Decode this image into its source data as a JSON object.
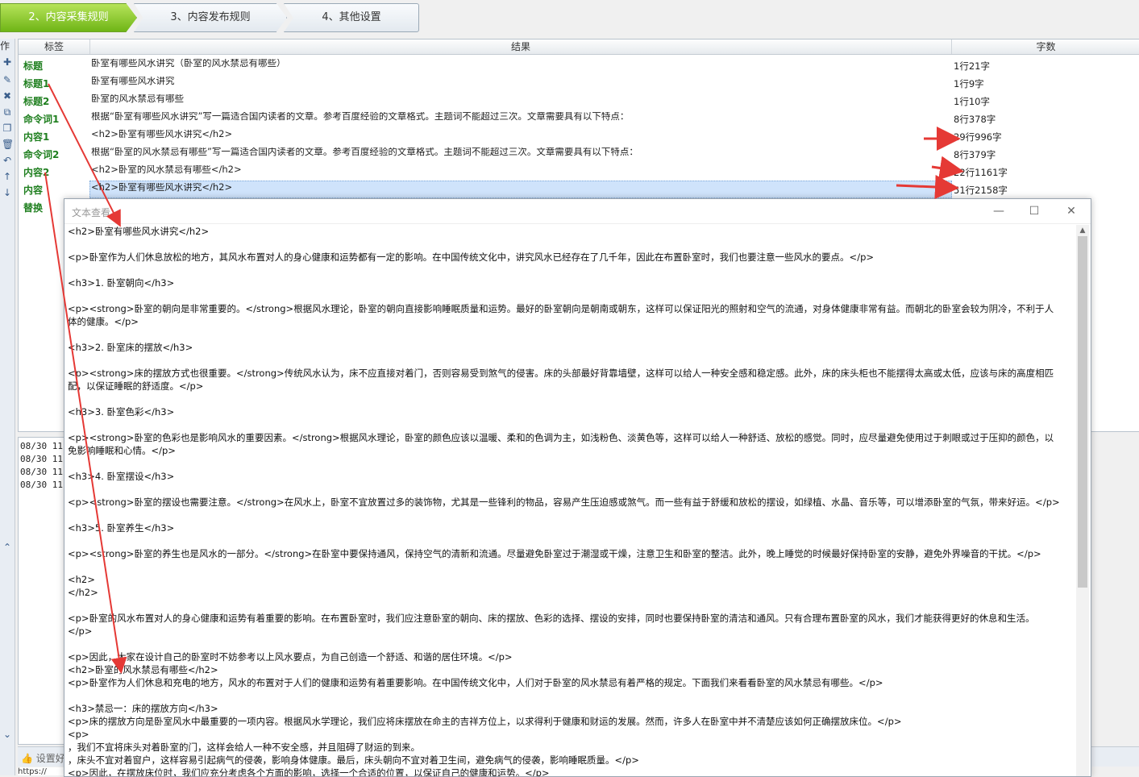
{
  "steps": {
    "tab2": "2、内容采集规则",
    "tab3": "3、内容发布规则",
    "tab4": "4、其他设置"
  },
  "toolstrip": {
    "label": "作"
  },
  "grid": {
    "headers": {
      "tag": "标签",
      "result": "结果",
      "count": "字数"
    },
    "rows": [
      {
        "tag": "标题",
        "result": "卧室有哪些风水讲究（卧室的风水禁忌有哪些）",
        "count": "1行21字"
      },
      {
        "tag": "标题1",
        "result": "卧室有哪些风水讲究",
        "count": "1行9字"
      },
      {
        "tag": "标题2",
        "result": "卧室的风水禁忌有哪些",
        "count": "1行10字"
      },
      {
        "tag": "命令词1",
        "result": "根据“卧室有哪些风水讲究”写一篇适合国内读者的文章。参考百度经验的文章格式。主题词不能超过三次。文章需要具有以下特点：",
        "count": "8行378字"
      },
      {
        "tag": "内容1",
        "result": "<h2>卧室有哪些风水讲究</h2>",
        "count": "29行996字"
      },
      {
        "tag": "命令词2",
        "result": "根据“卧室的风水禁忌有哪些”写一篇适合国内读者的文章。参考百度经验的文章格式。主题词不能超过三次。文章需要具有以下特点：",
        "count": "8行379字"
      },
      {
        "tag": "内容2",
        "result": "<h2>卧室的风水禁忌有哪些</h2>",
        "count": "22行1161字"
      },
      {
        "tag": "内容",
        "result": "<h2>卧室有哪些风水讲究</h2>",
        "count": "51行2158字"
      },
      {
        "tag": "替换",
        "result": "",
        "count": ""
      }
    ]
  },
  "log": {
    "lines": [
      "08/30 11:5",
      "08/30 11:5",
      "08/30 11:5",
      "08/30 11:5"
    ]
  },
  "status": {
    "label": "设置好"
  },
  "bottom": {
    "text": "https://"
  },
  "dialog": {
    "title": "文本查看",
    "lines": [
      "<h2>卧室有哪些风水讲究</h2>",
      "",
      "<p>卧室作为人们休息放松的地方，其风水布置对人的身心健康和运势都有一定的影响。在中国传统文化中，讲究风水已经存在了几千年，因此在布置卧室时，我们也要注意一些风水的要点。</p>",
      "",
      "<h3>1. 卧室朝向</h3>",
      "",
      "<p><strong>卧室的朝向是非常重要的。</strong>根据风水理论，卧室的朝向直接影响睡眠质量和运势。最好的卧室朝向是朝南或朝东，这样可以保证阳光的照射和空气的流通，对身体健康非常有益。而朝北的卧室会较为阴冷，不利于人",
      "体的健康。</p>",
      "",
      "<h3>2. 卧室床的摆放</h3>",
      "",
      "<p><strong>床的摆放方式也很重要。</strong>传统风水认为，床不应直接对着门，否则容易受到煞气的侵害。床的头部最好背靠墙壁，这样可以给人一种安全感和稳定感。此外，床的床头柜也不能摆得太高或太低，应该与床的高度相匹",
      "配，以保证睡眠的舒适度。</p>",
      "",
      "<h3>3. 卧室色彩</h3>",
      "",
      "<p><strong>卧室的色彩也是影响风水的重要因素。</strong>根据风水理论，卧室的颜色应该以温暖、柔和的色调为主，如浅粉色、淡黄色等，这样可以给人一种舒适、放松的感觉。同时，应尽量避免使用过于刺眼或过于压抑的颜色，以",
      "免影响睡眠和心情。</p>",
      "",
      "<h3>4. 卧室摆设</h3>",
      "",
      "<p><strong>卧室的摆设也需要注意。</strong>在风水上，卧室不宜放置过多的装饰物，尤其是一些锋利的物品，容易产生压迫感或煞气。而一些有益于舒缓和放松的摆设，如绿植、水晶、音乐等，可以增添卧室的气氛，带来好运。</p>",
      "",
      "<h3>5. 卧室养生</h3>",
      "",
      "<p><strong>卧室的养生也是风水的一部分。</strong>在卧室中要保持通风，保持空气的清新和流通。尽量避免卧室过于潮湿或干燥，注意卫生和卧室的整洁。此外，晚上睡觉的时候最好保持卧室的安静，避免外界噪音的干扰。</p>",
      "",
      "<h2>",
      "</h2>",
      "",
      "<p>卧室的风水布置对人的身心健康和运势有着重要的影响。在布置卧室时，我们应注意卧室的朝向、床的摆放、色彩的选择、摆设的安排，同时也要保持卧室的清洁和通风。只有合理布置卧室的风水，我们才能获得更好的休息和生活。",
      "</p>",
      "",
      "<p>因此，大家在设计自己的卧室时不妨参考以上风水要点，为自己创造一个舒适、和谐的居住环境。</p>",
      "<h2>卧室的风水禁忌有哪些</h2>",
      "<p>卧室作为人们休息和充电的地方，风水的布置对于人们的健康和运势有着重要影响。在中国传统文化中，人们对于卧室的风水禁忌有着严格的规定。下面我们来看看卧室的风水禁忌有哪些。</p>",
      "",
      "<h3>禁忌一：床的摆放方向</h3>",
      "<p>床的摆放方向是卧室风水中最重要的一项内容。根据风水学理论，我们应将床摆放在命主的吉祥方位上，以求得利于健康和财运的发展。然而，许多人在卧室中并不清楚应该如何正确摆放床位。</p>",
      "<p>",
      "，我们不宜将床头对着卧室的门，这样会给人一种不安全感，并且阻碍了财运的到来。",
      "，床头不宜对着窗户，这样容易引起病气的侵袭，影响身体健康。最后，床头朝向不宜对着卫生间，避免病气的侵袭，影响睡眠质量。</p>",
      "<p>因此，在摆放床位时，我们应充分考虑各个方面的影响，选择一个合适的位置，以保证自己的健康和运势。</p>"
    ]
  },
  "colors": {
    "accent": "#6fb516",
    "tag_green": "#1f7f1f",
    "arrow": "#e53935",
    "selection": "#cfe3fb"
  }
}
